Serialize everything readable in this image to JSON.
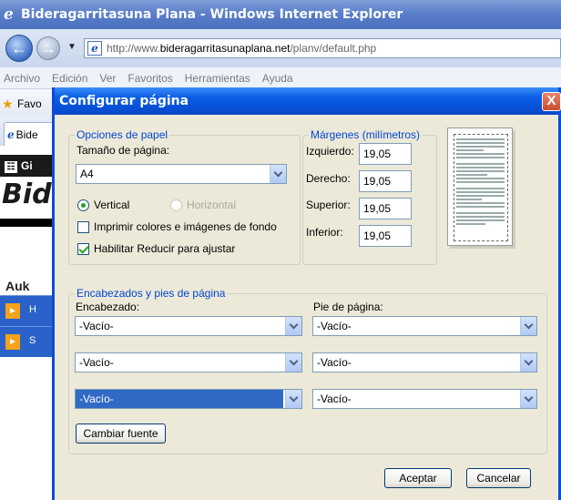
{
  "browser": {
    "window_title": "Bideragarritasuna Plana - Windows Internet Explorer",
    "address_prefix": "http://www.",
    "address_domain": "bideragarritasunaplana.net",
    "address_path": "/planv/default.php",
    "menu": [
      "Archivo",
      "Edición",
      "Ver",
      "Favoritos",
      "Herramientas",
      "Ayuda"
    ],
    "favorites_label": "Favo",
    "tab_label": "Bide"
  },
  "website": {
    "topbar_text": "Gi",
    "brand_text": "Bid",
    "aux_text": "Auk",
    "side_items": [
      {
        "char": "H"
      },
      {
        "char": "S"
      }
    ]
  },
  "dialog": {
    "title": "Configurar página",
    "close_label": "X",
    "paper": {
      "legend": "Opciones de papel",
      "page_size_label": "Tamaño de página:",
      "page_size_value": "A4",
      "orientation_vertical": "Vertical",
      "orientation_horizontal": "Horizontal",
      "print_colors_label": "Imprimir colores e imágenes de fondo",
      "print_colors_checked": false,
      "shrink_to_fit_label": "Habilitar Reducir para ajustar",
      "shrink_to_fit_checked": true
    },
    "margins": {
      "legend": "Márgenes (milímetros)",
      "left_label": "Izquierdo:",
      "left_value": "19,05",
      "right_label": "Derecho:",
      "right_value": "19,05",
      "top_label": "Superior:",
      "top_value": "19,05",
      "bottom_label": "Inferior:",
      "bottom_value": "19,05"
    },
    "headers_footers": {
      "legend": "Encabezados y pies de página",
      "header_label": "Encabezado:",
      "footer_label": "Pie de página:",
      "header_values": [
        "-Vacío-",
        "-Vacío-",
        "-Vacío-"
      ],
      "footer_values": [
        "-Vacío-",
        "-Vacío-",
        "-Vacío-"
      ],
      "change_font_label": "Cambiar fuente"
    },
    "accept_label": "Aceptar",
    "cancel_label": "Cancelar"
  },
  "colors": {
    "dialog_title_blue": "#0652d8",
    "legend_blue": "#0046d5",
    "selection_blue": "#316ac5",
    "dialog_bg": "#ece9d8"
  }
}
